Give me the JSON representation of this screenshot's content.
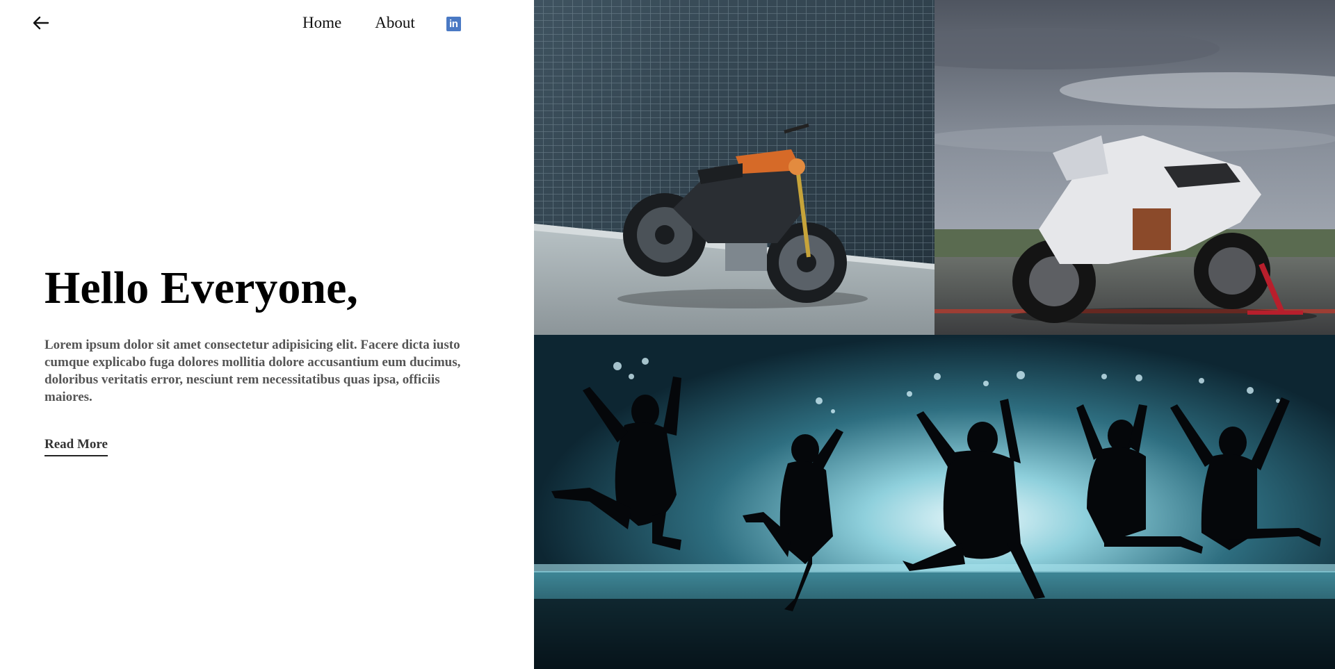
{
  "header": {
    "back_icon": "arrow-left-icon",
    "nav": {
      "home": "Home",
      "about": "About",
      "linkedin_icon": "linkedin-icon",
      "linkedin_glyph": "in"
    }
  },
  "hero": {
    "title": "Hello Everyone,",
    "body": "Lorem ipsum dolor sit amet consectetur adipisicing elit. Facere dicta iusto cumque explicabo fuga dolores mollitia dolore accusantium eum ducimus, doloribus veritatis error, nesciunt rem necessitatibus quas ipsa, officiis maiores.",
    "read_more": "Read More"
  },
  "gallery": {
    "images": [
      {
        "subject": "motorcycle-against-tile-wall"
      },
      {
        "subject": "white-sport-motorcycle-on-track"
      },
      {
        "subject": "jumping-silhouettes-at-beach"
      }
    ]
  },
  "colors": {
    "linkedin": "#4a79c4",
    "text_body": "#555555",
    "heading": "#000000"
  }
}
